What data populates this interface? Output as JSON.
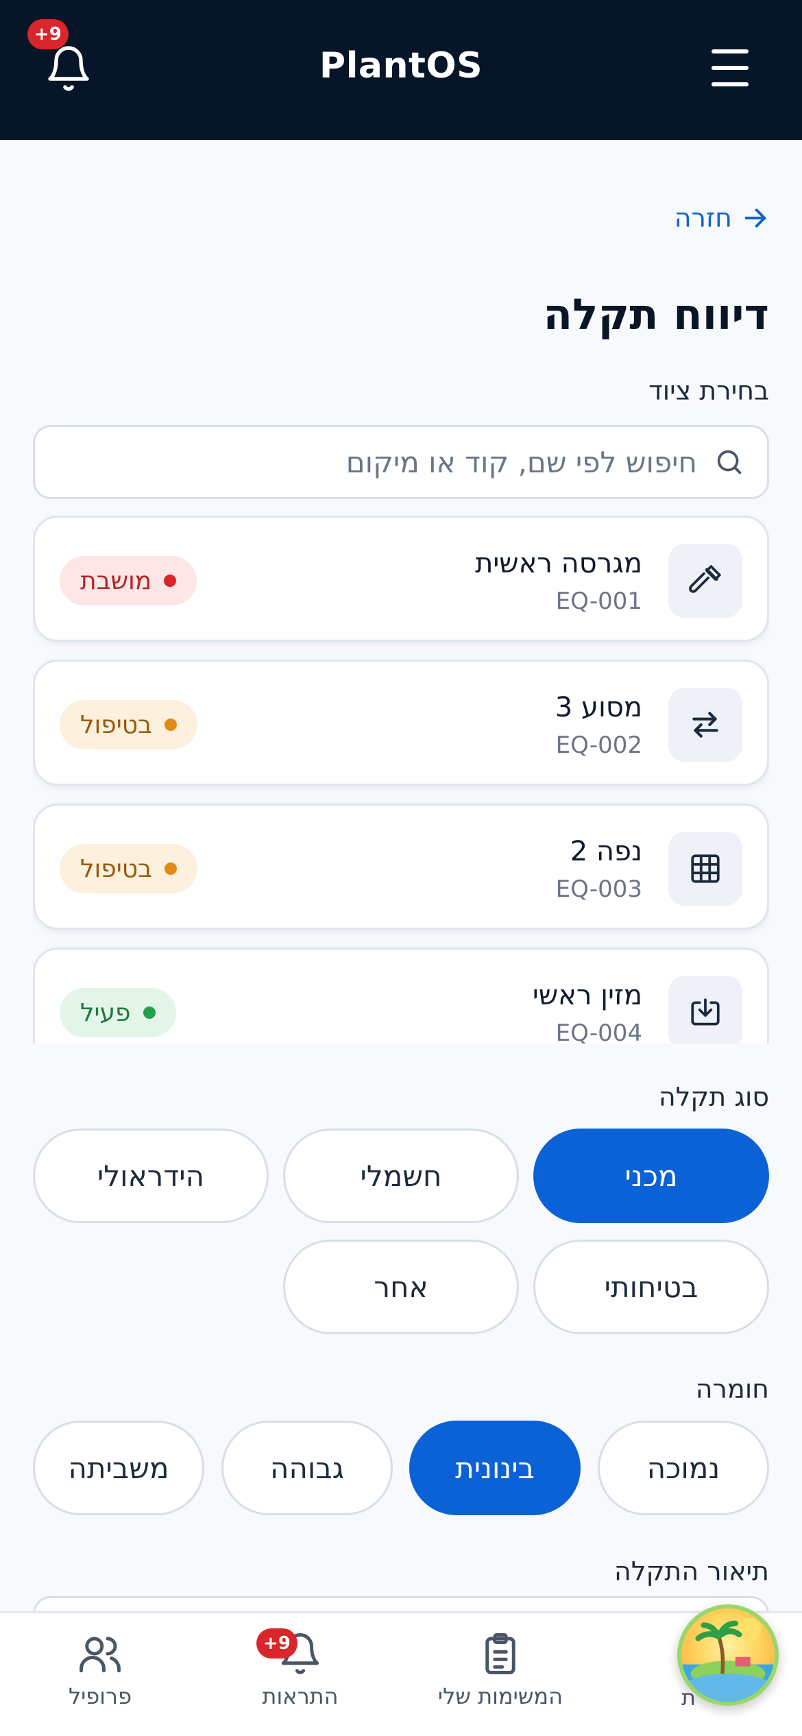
{
  "header": {
    "app_title": "PlantOS",
    "notification_badge": "+9"
  },
  "page": {
    "back_label": "חזרה",
    "title": "דיווח תקלה"
  },
  "equipment": {
    "label": "בחירת ציוד",
    "search_placeholder": "חיפוש לפי שם, קוד או מיקום",
    "items": [
      {
        "name": "מגרסה ראשית",
        "code": "EQ-001",
        "status": "מושבת",
        "icon": "hammer-icon"
      },
      {
        "name": "מסוע 3",
        "code": "EQ-002",
        "status": "בטיפול",
        "icon": "swap-arrows-icon"
      },
      {
        "name": "נפה 2",
        "code": "EQ-003",
        "status": "בטיפול",
        "icon": "grid-icon"
      },
      {
        "name": "מזין ראשי",
        "code": "EQ-004",
        "status": "פעיל",
        "icon": "tray-download-icon"
      }
    ]
  },
  "fault_type": {
    "label": "סוג תקלה",
    "options": [
      "מכני",
      "חשמלי",
      "הידראולי",
      "בטיחותי",
      "אחר"
    ],
    "selected": "מכני"
  },
  "severity": {
    "label": "חומרה",
    "options": [
      "נמוכה",
      "בינונית",
      "גבוהה",
      "משביתה"
    ],
    "selected": "בינונית"
  },
  "description": {
    "label": "תיאור התקלה"
  },
  "bottom_nav": {
    "items": [
      {
        "label": "פרופיל",
        "icon": "users-icon"
      },
      {
        "label": "התראות",
        "icon": "bell-icon",
        "badge": "+9"
      },
      {
        "label": "המשימות שלי",
        "icon": "clipboard-icon"
      },
      {
        "label": "ת",
        "icon": "island-avatar-icon"
      }
    ]
  },
  "colors": {
    "header_bg": "#061528",
    "accent": "#0b62d6",
    "status_down": "#d9262b",
    "status_maintenance": "#e08a17",
    "status_active": "#22a04a"
  }
}
